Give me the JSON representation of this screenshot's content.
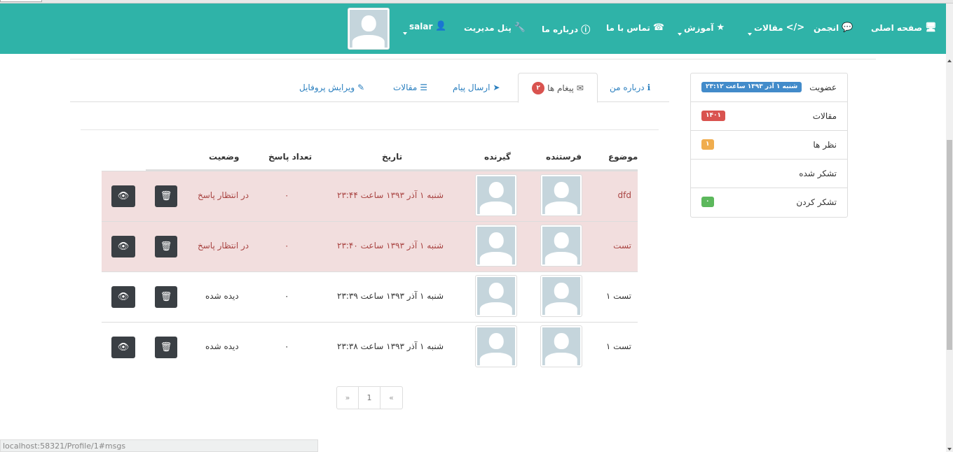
{
  "nav": {
    "home": "صفحه اصلی",
    "forum": "انجمن",
    "articles": "مقالات",
    "education": "آموزش",
    "contact": "تماس با ما",
    "about": "درباره ما",
    "admin_panel": "پنل مدیریت",
    "user": "salar"
  },
  "icons": {
    "home": "desktop-icon",
    "forum": "comments-icon",
    "articles": "code-icon",
    "education": "star-icon",
    "contact": "phone-icon",
    "about": "info-icon",
    "admin": "wrench-icon",
    "user": "user-icon"
  },
  "side_panel": {
    "rows": [
      {
        "label": "عضویت",
        "badge": "شنبه ۱ آذر ۱۳۹۳ ساعت ۲۳:۱۲",
        "badge_color": "#428bca"
      },
      {
        "label": "مقالات",
        "badge": "۱۴۰۱",
        "badge_color": "#d9534f"
      },
      {
        "label": "نظر ها",
        "badge": "۱",
        "badge_color": "#f0ad4e"
      },
      {
        "label": "تشکر شده",
        "badge": "",
        "badge_color": ""
      },
      {
        "label": "تشکر کردن",
        "badge": "۰",
        "badge_color": "#5cb85c"
      }
    ]
  },
  "tabs": {
    "about_me": "درباره من",
    "messages": "پیغام ها",
    "messages_count": "۲",
    "send_message": "ارسال پیام",
    "articles": "مقالات",
    "edit_profile": "ویرایش پروفایل"
  },
  "table": {
    "headers": {
      "subject": "موضوع",
      "sender": "فرستنده",
      "receiver": "گیرنده",
      "date": "تاریخ",
      "replies": "تعداد پاسخ",
      "status": "وضعیت"
    },
    "rows": [
      {
        "subject": "dfd",
        "date": "شنبه ۱ آذر ۱۳۹۳ ساعت ۲۳:۴۴",
        "replies": "۰",
        "status": "در انتظار پاسخ",
        "state": "pending"
      },
      {
        "subject": "تست",
        "date": "شنبه ۱ آذر ۱۳۹۳ ساعت ۲۳:۴۰",
        "replies": "۰",
        "status": "در انتظار پاسخ",
        "state": "pending"
      },
      {
        "subject": "تست ۱",
        "date": "شنبه ۱ آذر ۱۳۹۳ ساعت ۲۳:۳۹",
        "replies": "۰",
        "status": "دیده شده",
        "state": "seen"
      },
      {
        "subject": "تست ۱",
        "date": "شنبه ۱ آذر ۱۳۹۳ ساعت ۲۳:۳۸",
        "replies": "۰",
        "status": "دیده شده",
        "state": "seen"
      }
    ]
  },
  "pager": {
    "prev": "«",
    "page": "1",
    "next": "»"
  },
  "status_bar": "localhost:58321/Profile/1#msgs",
  "colors": {
    "navbar": "#2fb3a8",
    "pending_row": "#f2dede",
    "link": "#2a7fbf"
  }
}
